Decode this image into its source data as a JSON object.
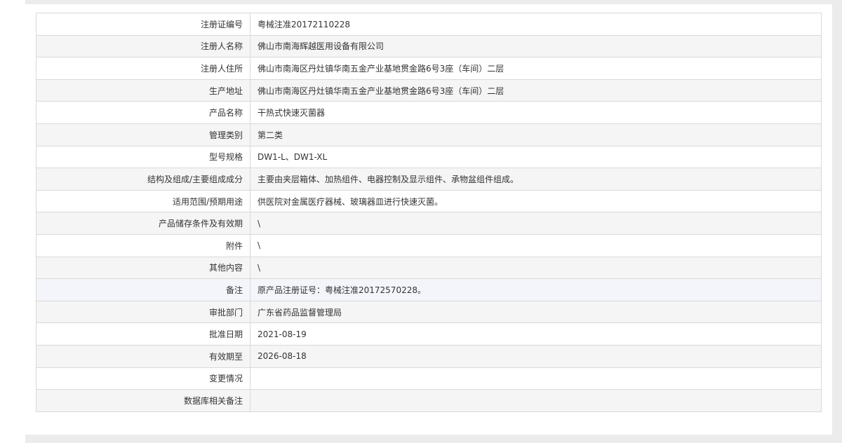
{
  "rows": [
    {
      "label": "注册证编号",
      "value": "粤械注准20172110228"
    },
    {
      "label": "注册人名称",
      "value": "佛山市南海辉越医用设备有限公司"
    },
    {
      "label": "注册人住所",
      "value": "佛山市南海区丹灶镇华南五金产业基地贯金路6号3座（车间）二层"
    },
    {
      "label": "生产地址",
      "value": "佛山市南海区丹灶镇华南五金产业基地贯金路6号3座（车间）二层"
    },
    {
      "label": "产品名称",
      "value": "干热式快速灭菌器"
    },
    {
      "label": "管理类别",
      "value": "第二类"
    },
    {
      "label": "型号规格",
      "value": "DW1-L、DW1-XL"
    },
    {
      "label": "结构及组成/主要组成成分",
      "value": "主要由夹层箱体、加热组件、电器控制及显示组件、承物盆组件组成。"
    },
    {
      "label": "适用范围/预期用途",
      "value": "供医院对金属医疗器械、玻璃器皿进行快速灭菌。"
    },
    {
      "label": "产品储存条件及有效期",
      "value": "\\"
    },
    {
      "label": "附件",
      "value": "\\"
    },
    {
      "label": "其他内容",
      "value": "\\"
    },
    {
      "label": "备注",
      "value": "原产品注册证号：粤械注准20172570228。"
    },
    {
      "label": "审批部门",
      "value": "广东省药品监督管理局"
    },
    {
      "label": "批准日期",
      "value": "2021-08-19"
    },
    {
      "label": "有效期至",
      "value": "2026-08-18"
    },
    {
      "label": "变更情况",
      "value": ""
    },
    {
      "label": "数据库相关备注",
      "value": ""
    }
  ]
}
